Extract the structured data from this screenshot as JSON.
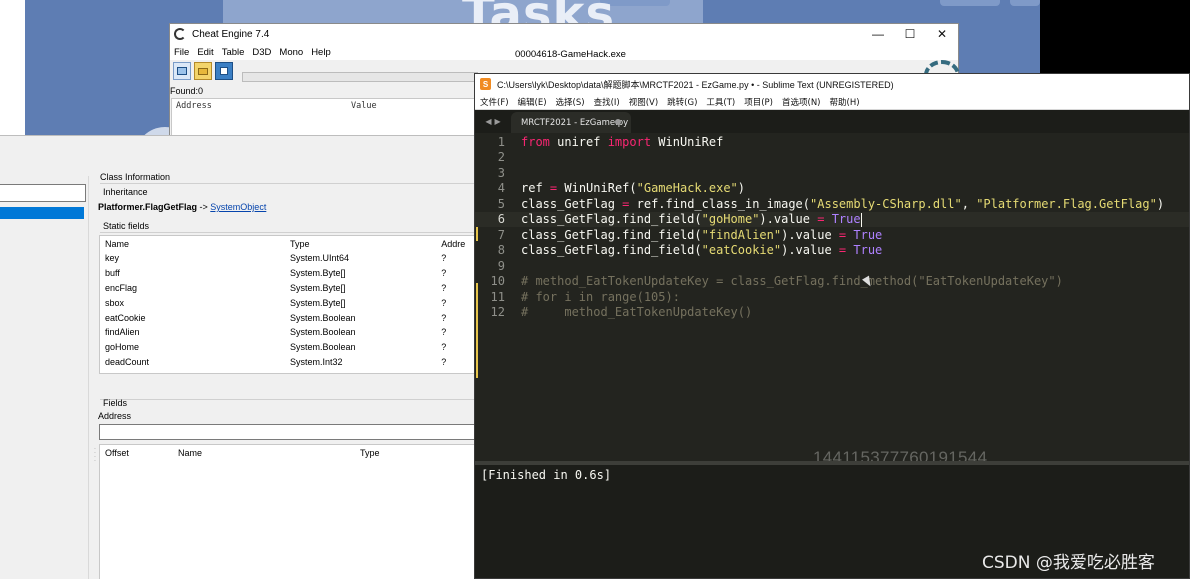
{
  "cheat_engine": {
    "title": "Cheat Engine 7.4",
    "menu": [
      "File",
      "Edit",
      "Table",
      "D3D",
      "Mono",
      "Help"
    ],
    "process": "00004618-GameHack.exe",
    "found": "Found:0",
    "columns": [
      "Address",
      "Value"
    ],
    "window_buttons": [
      "minimize-icon",
      "maximize-icon",
      "close-icon"
    ]
  },
  "background": {
    "video_text": "Tasks"
  },
  "mono_dissector": {
    "class_information_label": "Class Information",
    "inheritance_label": "Inheritance",
    "class_name": "Platformer.FlagGetFlag",
    "inherit_arrow": " -> ",
    "parent_class": "SystemObject",
    "static_fields_label": "Static fields",
    "static_columns": [
      "Name",
      "Type",
      "Addre"
    ],
    "static_fields": [
      {
        "name": "key",
        "type": "System.UInt64",
        "addr": "?"
      },
      {
        "name": "buff",
        "type": "System.Byte[]",
        "addr": "?"
      },
      {
        "name": "encFlag",
        "type": "System.Byte[]",
        "addr": "?"
      },
      {
        "name": "sbox",
        "type": "System.Byte[]",
        "addr": "?"
      },
      {
        "name": "eatCookie",
        "type": "System.Boolean",
        "addr": "?"
      },
      {
        "name": "findAlien",
        "type": "System.Boolean",
        "addr": "?"
      },
      {
        "name": "goHome",
        "type": "System.Boolean",
        "addr": "?"
      },
      {
        "name": "deadCount",
        "type": "System.Int32",
        "addr": "?"
      }
    ],
    "fields_label": "Fields",
    "address_label": "Address",
    "fields_columns": [
      "Offset",
      "Name",
      "Type"
    ],
    "splitter_glyph": "......"
  },
  "sublime": {
    "title": "C:\\Users\\lyk\\Desktop\\data\\解题脚本\\MRCTF2021 - EzGame.py • - Sublime Text (UNREGISTERED)",
    "menu": [
      "文件(F)",
      "编辑(E)",
      "选择(S)",
      "查找(I)",
      "视图(V)",
      "跳转(G)",
      "工具(T)",
      "项目(P)",
      "首选项(N)",
      "帮助(H)"
    ],
    "tab_label": "MRCTF2021 - EzGame.py",
    "line_numbers": [
      "1",
      "2",
      "3",
      "4",
      "5",
      "6",
      "7",
      "8",
      "9",
      "10",
      "11",
      "12"
    ],
    "code": {
      "l1": {
        "kw1": "from",
        "mod": " uniref ",
        "kw2": "import",
        "name": " WinUniRef"
      },
      "l4": {
        "pre": "ref ",
        "eq": "=",
        "mid": " WinUniRef(",
        "str": "\"GameHack.exe\"",
        "post": ")"
      },
      "l5": {
        "pre": "class_GetFlag ",
        "eq": "=",
        "mid": " ref.find_class_in_image(",
        "s1": "\"Assembly-CSharp.dll\"",
        "sep": ", ",
        "s2": "\"Platformer.Flag.GetFlag\"",
        "post": ")"
      },
      "l6": {
        "pre": "class_GetFlag.find_field(",
        "str": "\"goHome\"",
        "mid": ").value ",
        "eq": "=",
        "sp": " ",
        "val": "True"
      },
      "l7": {
        "pre": "class_GetFlag.find_field(",
        "str": "\"findAlien\"",
        "mid": ").value ",
        "eq": "=",
        "sp": " ",
        "val": "True"
      },
      "l8": {
        "pre": "class_GetFlag.find_field(",
        "str": "\"eatCookie\"",
        "mid": ").value ",
        "eq": "=",
        "sp": " ",
        "val": "True"
      },
      "l10": "# method_EatTokenUpdateKey = class_GetFlag.find_method(\"EatTokenUpdateKey\")",
      "l11": "# for i in range(105):",
      "l12": "#     method_EatTokenUpdateKey()"
    },
    "output": "[Finished in 0.6s]",
    "overlay_number": "144115377760191544"
  },
  "watermark": "CSDN @我爱吃必胜客"
}
